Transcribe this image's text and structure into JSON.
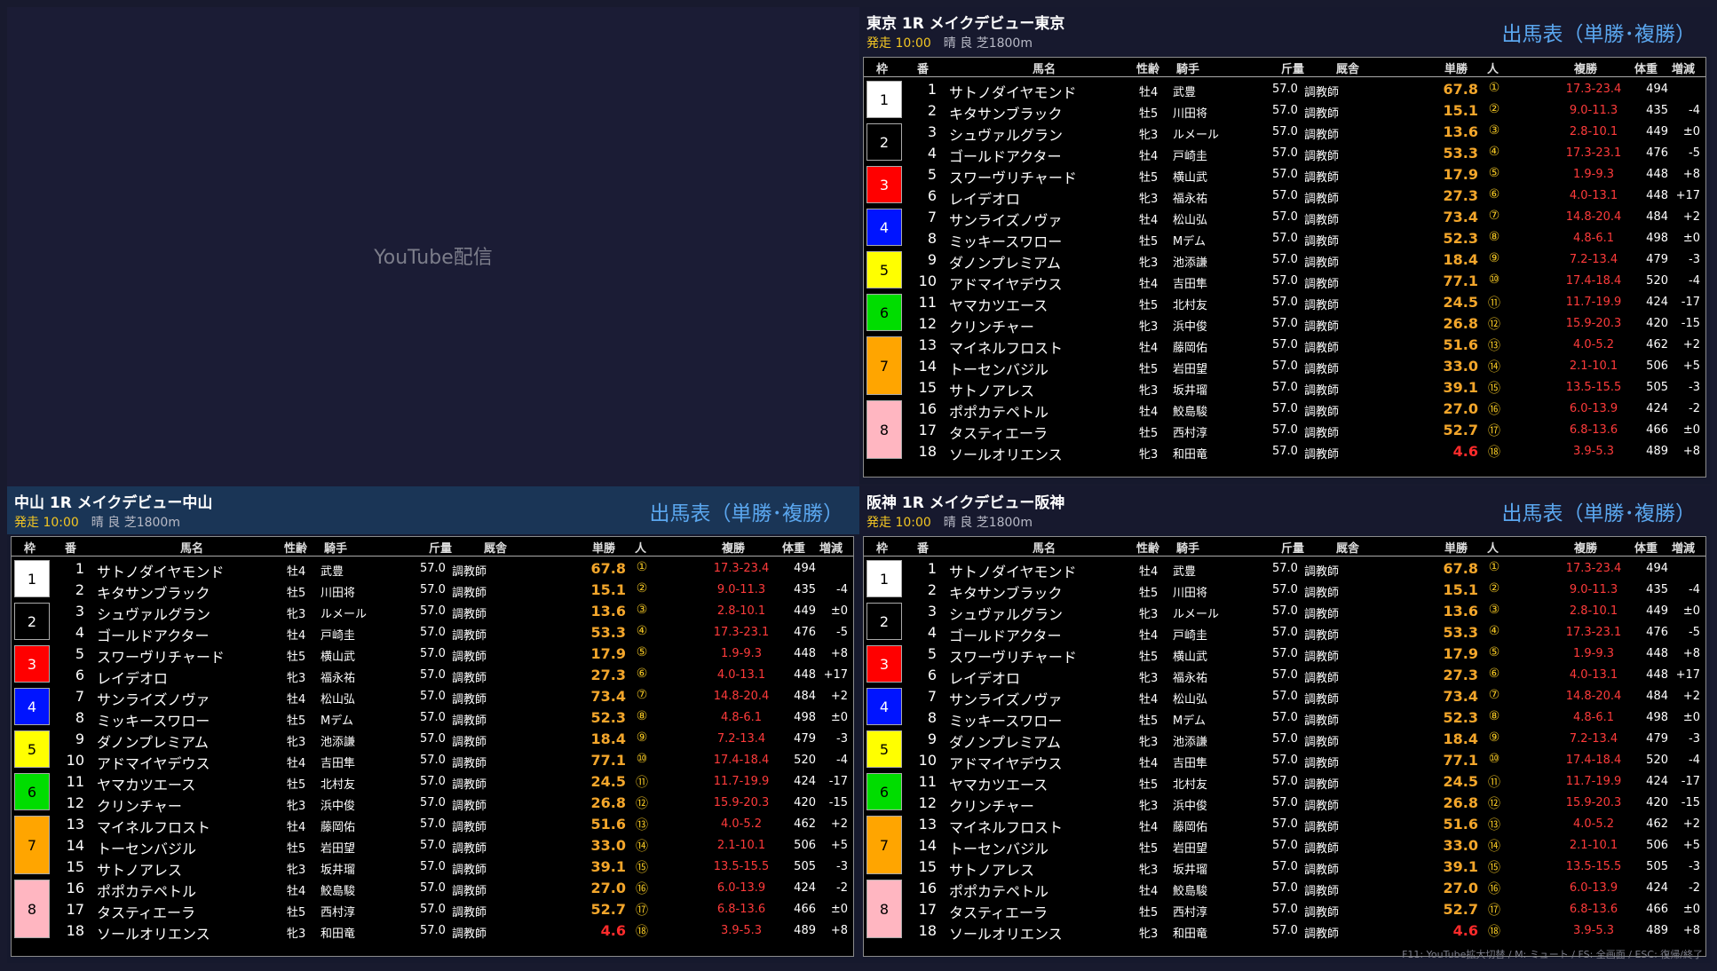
{
  "youtube": {
    "label": "YouTube配信"
  },
  "columns": [
    "枠",
    "番",
    "馬名",
    "性齢",
    "騎手",
    "斤量",
    "厩舎",
    "単勝",
    "人",
    "複勝",
    "体重",
    "増減"
  ],
  "waku_colors": [
    {
      "bg": "#ffffff",
      "fg": "#000000"
    },
    {
      "bg": "#000000",
      "fg": "#ffffff"
    },
    {
      "bg": "#ff0000",
      "fg": "#ffffff"
    },
    {
      "bg": "#0014ff",
      "fg": "#ffffff"
    },
    {
      "bg": "#ffff00",
      "fg": "#000000"
    },
    {
      "bg": "#00dd00",
      "fg": "#000000"
    },
    {
      "bg": "#ffa500",
      "fg": "#000000"
    },
    {
      "bg": "#ffb6c1",
      "fg": "#000000"
    }
  ],
  "waku_groups": [
    {
      "label": "1",
      "rows": 2
    },
    {
      "label": "2",
      "rows": 2
    },
    {
      "label": "3",
      "rows": 2
    },
    {
      "label": "4",
      "rows": 2
    },
    {
      "label": "5",
      "rows": 2
    },
    {
      "label": "6",
      "rows": 2
    },
    {
      "label": "7",
      "rows": 3
    },
    {
      "label": "8",
      "rows": 3
    }
  ],
  "races": [
    {
      "id": "tokyo",
      "title": "東京 1R メイクデビュー東京",
      "start": "発走 10:00",
      "condition": "晴 良 芝1800m",
      "type": "出馬表（単勝･複勝）"
    },
    {
      "id": "nakayama",
      "title": "中山 1R メイクデビュー中山",
      "start": "発走 10:00",
      "condition": "晴 良 芝1800m",
      "type": "出馬表（単勝･複勝）"
    },
    {
      "id": "hanshin",
      "title": "阪神 1R メイクデビュー阪神",
      "start": "発走 10:00",
      "condition": "晴 良 芝1800m",
      "type": "出馬表（単勝･複勝）"
    }
  ],
  "horses": [
    {
      "num": "1",
      "name": "サトノダイヤモンド",
      "sex": "牡4",
      "jockey": "武豊",
      "weight": "57.0",
      "trainer": "調教師",
      "win": "67.8",
      "pop": "①",
      "place": "17.3-23.4",
      "bw": "494",
      "diff": ""
    },
    {
      "num": "2",
      "name": "キタサンブラック",
      "sex": "牡5",
      "jockey": "川田将",
      "weight": "57.0",
      "trainer": "調教師",
      "win": "15.1",
      "pop": "②",
      "place": "9.0-11.3",
      "bw": "435",
      "diff": "-4"
    },
    {
      "num": "3",
      "name": "シュヴァルグラン",
      "sex": "牝3",
      "jockey": "ルメール",
      "weight": "57.0",
      "trainer": "調教師",
      "win": "13.6",
      "pop": "③",
      "place": "2.8-10.1",
      "bw": "449",
      "diff": "±0"
    },
    {
      "num": "4",
      "name": "ゴールドアクター",
      "sex": "牡4",
      "jockey": "戸崎圭",
      "weight": "57.0",
      "trainer": "調教師",
      "win": "53.3",
      "pop": "④",
      "place": "17.3-23.1",
      "bw": "476",
      "diff": "-5"
    },
    {
      "num": "5",
      "name": "スワーヴリチャード",
      "sex": "牡5",
      "jockey": "横山武",
      "weight": "57.0",
      "trainer": "調教師",
      "win": "17.9",
      "pop": "⑤",
      "place": "1.9-9.3",
      "bw": "448",
      "diff": "+8"
    },
    {
      "num": "6",
      "name": "レイデオロ",
      "sex": "牝3",
      "jockey": "福永祐",
      "weight": "57.0",
      "trainer": "調教師",
      "win": "27.3",
      "pop": "⑥",
      "place": "4.0-13.1",
      "bw": "448",
      "diff": "+17"
    },
    {
      "num": "7",
      "name": "サンライズノヴァ",
      "sex": "牡4",
      "jockey": "松山弘",
      "weight": "57.0",
      "trainer": "調教師",
      "win": "73.4",
      "pop": "⑦",
      "place": "14.8-20.4",
      "bw": "484",
      "diff": "+2"
    },
    {
      "num": "8",
      "name": "ミッキースワロー",
      "sex": "牡5",
      "jockey": "Mデム",
      "weight": "57.0",
      "trainer": "調教師",
      "win": "52.3",
      "pop": "⑧",
      "place": "4.8-6.1",
      "bw": "498",
      "diff": "±0"
    },
    {
      "num": "9",
      "name": "ダノンプレミアム",
      "sex": "牝3",
      "jockey": "池添謙",
      "weight": "57.0",
      "trainer": "調教師",
      "win": "18.4",
      "pop": "⑨",
      "place": "7.2-13.4",
      "bw": "479",
      "diff": "-3"
    },
    {
      "num": "10",
      "name": "アドマイヤデウス",
      "sex": "牡4",
      "jockey": "吉田隼",
      "weight": "57.0",
      "trainer": "調教師",
      "win": "77.1",
      "pop": "⑩",
      "place": "17.4-18.4",
      "bw": "520",
      "diff": "-4"
    },
    {
      "num": "11",
      "name": "ヤマカツエース",
      "sex": "牡5",
      "jockey": "北村友",
      "weight": "57.0",
      "trainer": "調教師",
      "win": "24.5",
      "pop": "⑪",
      "place": "11.7-19.9",
      "bw": "424",
      "diff": "-17"
    },
    {
      "num": "12",
      "name": "クリンチャー",
      "sex": "牝3",
      "jockey": "浜中俊",
      "weight": "57.0",
      "trainer": "調教師",
      "win": "26.8",
      "pop": "⑫",
      "place": "15.9-20.3",
      "bw": "420",
      "diff": "-15"
    },
    {
      "num": "13",
      "name": "マイネルフロスト",
      "sex": "牡4",
      "jockey": "藤岡佑",
      "weight": "57.0",
      "trainer": "調教師",
      "win": "51.6",
      "pop": "⑬",
      "place": "4.0-5.2",
      "bw": "462",
      "diff": "+2"
    },
    {
      "num": "14",
      "name": "トーセンバジル",
      "sex": "牡5",
      "jockey": "岩田望",
      "weight": "57.0",
      "trainer": "調教師",
      "win": "33.0",
      "pop": "⑭",
      "place": "2.1-10.1",
      "bw": "506",
      "diff": "+5"
    },
    {
      "num": "15",
      "name": "サトノアレス",
      "sex": "牝3",
      "jockey": "坂井瑠",
      "weight": "57.0",
      "trainer": "調教師",
      "win": "39.1",
      "pop": "⑮",
      "place": "13.5-15.5",
      "bw": "505",
      "diff": "-3"
    },
    {
      "num": "16",
      "name": "ポポカテペトル",
      "sex": "牡4",
      "jockey": "鮫島駿",
      "weight": "57.0",
      "trainer": "調教師",
      "win": "27.0",
      "pop": "⑯",
      "place": "6.0-13.9",
      "bw": "424",
      "diff": "-2"
    },
    {
      "num": "17",
      "name": "タスティエーラ",
      "sex": "牡5",
      "jockey": "西村淳",
      "weight": "57.0",
      "trainer": "調教師",
      "win": "52.7",
      "pop": "⑰",
      "place": "6.8-13.6",
      "bw": "466",
      "diff": "±0"
    },
    {
      "num": "18",
      "name": "ソールオリエンス",
      "sex": "牝3",
      "jockey": "和田竜",
      "weight": "57.0",
      "trainer": "調教師",
      "win": "4.6",
      "pop": "⑱",
      "place": "3.9-5.3",
      "bw": "489",
      "diff": "+8"
    }
  ],
  "footer_hint": "F11: YouTube拡大切替 / M: ミュート / FS: 全画面 / ESC: 復帰/終了"
}
